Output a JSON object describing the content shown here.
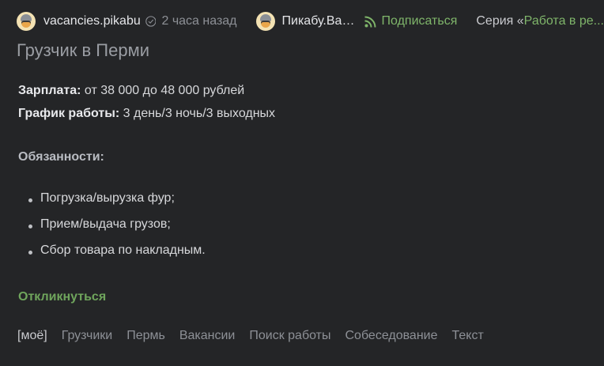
{
  "post": {
    "author": "vacancies.pikabu",
    "time": "2 часа назад",
    "community": "Пикабу.Вак...",
    "subscribe_label": "Подписаться",
    "series_prefix": "Серия «",
    "series_link": "Работа в ре...",
    "title": "Грузчик в Перми"
  },
  "details": {
    "salary_label": "Зарплата:",
    "salary_value": " от 38 000 до 48 000 рублей",
    "schedule_label": "График работы:",
    "schedule_value": " 3 день/3 ночь/3 выходных"
  },
  "duties": {
    "heading": "Обязанности:",
    "items": [
      "Погрузка/вырузка фур;",
      "Прием/выдача грузов;",
      "Сбор товара по накладным."
    ]
  },
  "respond_label": "Откликнуться",
  "tags": [
    "[моё]",
    "Грузчики",
    "Пермь",
    "Вакансии",
    "Поиск работы",
    "Собеседование",
    "Текст"
  ],
  "colors": {
    "background": "#242527",
    "accent_green": "#7fb56a",
    "muted": "#8d9096"
  },
  "icons": {
    "verified": "verified-check-icon",
    "subscribe": "rss-icon"
  }
}
